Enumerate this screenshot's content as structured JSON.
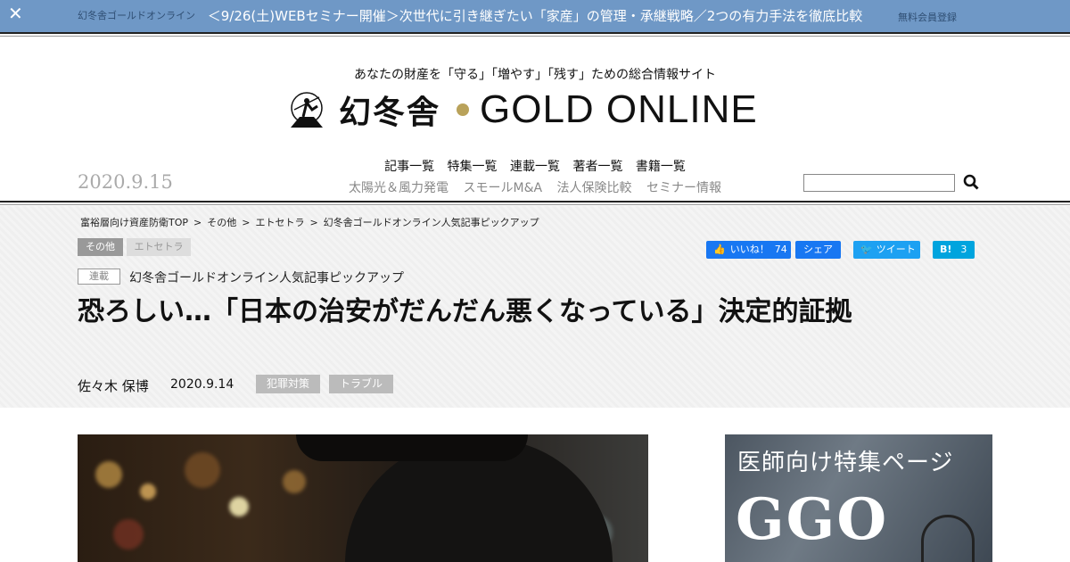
{
  "topbar": {
    "background_text": "幻冬舎ゴールドオンライン",
    "message": "＜9/26(土)WEBセミナー開催＞次世代に引き継ぎたい「家産」の管理・承継戦略／2つの有力手法を徹底比較",
    "right_link": "無料会員登録",
    "close_icon": "close-icon"
  },
  "header": {
    "tagline": "あなたの財産を「守る」「増やす」「残す」ための総合情報サイト",
    "logo_kanji": "幻冬舎",
    "logo_en": "GOLD ONLINE",
    "date": "2020.9.15"
  },
  "nav": {
    "primary": [
      "記事一覧",
      "特集一覧",
      "連載一覧",
      "著者一覧",
      "書籍一覧"
    ],
    "secondary": [
      "太陽光＆風力発電",
      "スモールM&A",
      "法人保険比較",
      "セミナー情報"
    ],
    "search_icon": "search-icon"
  },
  "breadcrumb": [
    "富裕層向け資産防衛TOP",
    "その他",
    "エトセトラ",
    "幻冬舎ゴールドオンライン人気記事ピックアップ"
  ],
  "categories": [
    "その他",
    "エトセトラ"
  ],
  "social": {
    "like_label": "いいね！",
    "like_count": "74",
    "share_label": "シェア",
    "tweet_label": "ツイート",
    "hatena_label": "B!",
    "hatena_count": "3"
  },
  "article": {
    "series_tag": "連載",
    "series_name": "幻冬舎ゴールドオンライン人気記事ピックアップ",
    "title": "恐ろしい…「日本の治安がだんだん悪くなっている」決定的証拠",
    "author": "佐々木 保博",
    "date": "2020.9.14",
    "tags": [
      "犯罪対策",
      "トラブル"
    ]
  },
  "ad": {
    "title": "医師向け特集ページ",
    "brand": "GGO"
  },
  "colors": {
    "topbar": "#6f98c6",
    "facebook": "#1877f2",
    "twitter": "#1da1f2",
    "hatena": "#00a4de"
  }
}
